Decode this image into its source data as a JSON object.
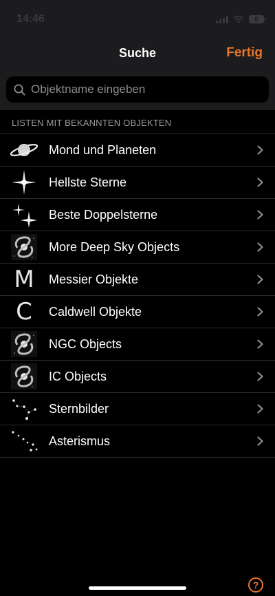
{
  "status_bar": {
    "time": "14:46",
    "battery": "6"
  },
  "nav": {
    "title": "Suche",
    "done_label": "Fertig"
  },
  "search": {
    "placeholder": "Objektname eingeben",
    "value": ""
  },
  "section": {
    "header": "LISTEN MIT BEKANNTEN OBJEKTEN"
  },
  "items": [
    {
      "label": "Mond und Planeten",
      "icon": "saturn-icon"
    },
    {
      "label": "Hellste Sterne",
      "icon": "bright-star-icon"
    },
    {
      "label": "Beste Doppelsterne",
      "icon": "double-star-icon"
    },
    {
      "label": "More Deep Sky Objects",
      "icon": "galaxy-icon"
    },
    {
      "label": "Messier Objekte",
      "icon": "messier-letter-icon",
      "glyph": "M"
    },
    {
      "label": "Caldwell Objekte",
      "icon": "caldwell-letter-icon",
      "glyph": "C"
    },
    {
      "label": "NGC Objects",
      "icon": "galaxy-icon"
    },
    {
      "label": "IC Objects",
      "icon": "galaxy-icon"
    },
    {
      "label": "Sternbilder",
      "icon": "constellation-icon"
    },
    {
      "label": "Asterismus",
      "icon": "asterism-icon"
    }
  ],
  "help_label": "?",
  "colors": {
    "accent": "#e8762b",
    "background": "#000000",
    "bar": "#1c1c1e"
  }
}
